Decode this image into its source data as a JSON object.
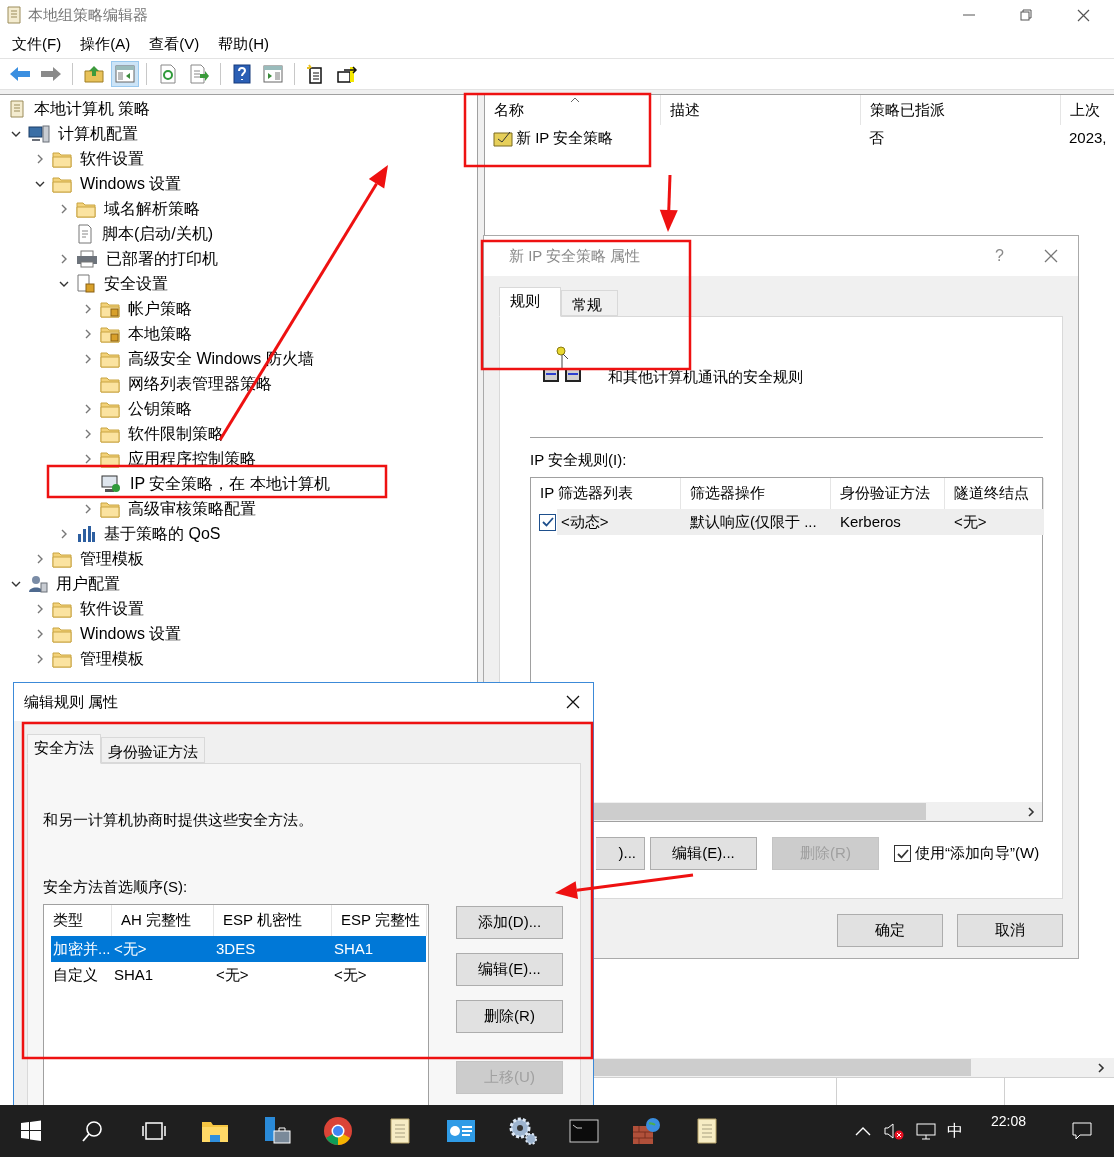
{
  "window": {
    "title": "本地组策略编辑器"
  },
  "menu": [
    "文件(F)",
    "操作(A)",
    "查看(V)",
    "帮助(H)"
  ],
  "toolbar": [
    {
      "kind": "back",
      "pressed": false
    },
    {
      "kind": "forward",
      "pressed": false
    },
    {
      "kind": "separator"
    },
    {
      "kind": "up",
      "pressed": false
    },
    {
      "kind": "tree-pane",
      "pressed": true
    },
    {
      "kind": "separator"
    },
    {
      "kind": "refresh",
      "pressed": false
    },
    {
      "kind": "export",
      "pressed": false
    },
    {
      "kind": "separator"
    },
    {
      "kind": "help",
      "pressed": false
    },
    {
      "kind": "action-pane",
      "pressed": false
    },
    {
      "kind": "separator"
    },
    {
      "kind": "new-doc",
      "pressed": false
    },
    {
      "kind": "move",
      "pressed": false
    }
  ],
  "tree": [
    {
      "label": "本地计算机 策略",
      "kind": "policy",
      "children": [
        {
          "label": "计算机配置",
          "kind": "computer",
          "expanded": true,
          "children": [
            {
              "label": "软件设置",
              "kind": "folder",
              "expanded": false
            },
            {
              "label": "Windows 设置",
              "kind": "folder",
              "expanded": true,
              "children": [
                {
                  "label": "域名解析策略",
                  "kind": "folder",
                  "expanded": false
                },
                {
                  "label": "脚本(启动/关机)",
                  "kind": "script"
                },
                {
                  "label": "已部署的打印机",
                  "kind": "printer",
                  "expanded": false
                },
                {
                  "label": "安全设置",
                  "kind": "security",
                  "expanded": true,
                  "children": [
                    {
                      "label": "帐户策略",
                      "kind": "lock-folder",
                      "expanded": false
                    },
                    {
                      "label": "本地策略",
                      "kind": "lock-folder",
                      "expanded": false
                    },
                    {
                      "label": "高级安全 Windows 防火墙",
                      "kind": "folder",
                      "expanded": false
                    },
                    {
                      "label": "网络列表管理器策略",
                      "kind": "folder"
                    },
                    {
                      "label": "公钥策略",
                      "kind": "folder",
                      "expanded": false
                    },
                    {
                      "label": "软件限制策略",
                      "kind": "folder",
                      "expanded": false
                    },
                    {
                      "label": "应用程序控制策略",
                      "kind": "folder",
                      "expanded": false
                    },
                    {
                      "label": "IP 安全策略，在 本地计算机",
                      "kind": "ipsec"
                    },
                    {
                      "label": "高级审核策略配置",
                      "kind": "folder",
                      "expanded": false
                    }
                  ]
                },
                {
                  "label": "基于策略的 QoS",
                  "kind": "qos",
                  "expanded": false
                }
              ]
            },
            {
              "label": "管理模板",
              "kind": "folder",
              "expanded": false
            }
          ]
        },
        {
          "label": "用户配置",
          "kind": "user",
          "expanded": true,
          "children": [
            {
              "label": "软件设置",
              "kind": "folder",
              "expanded": false
            },
            {
              "label": "Windows 设置",
              "kind": "folder",
              "expanded": false
            },
            {
              "label": "管理模板",
              "kind": "folder",
              "expanded": false
            }
          ]
        }
      ]
    }
  ],
  "list": {
    "columns": [
      "名称",
      "描述",
      "策略已指派",
      "上次"
    ],
    "rows": [
      {
        "cells": [
          "新 IP 安全策略",
          "",
          "否",
          "2023,"
        ]
      }
    ]
  },
  "ip_dialog": {
    "title": "新 IP 安全策略 属性",
    "help": "?",
    "tabs": [
      {
        "label": "规则",
        "selected": true
      },
      {
        "label": "常规",
        "selected": false
      }
    ],
    "description": "和其他计算机通讯的安全规则",
    "rules_label": "IP 安全规则(I):",
    "columns": [
      "IP 筛选器列表",
      "筛选器操作",
      "身份验证方法",
      "隧道终结点"
    ],
    "rows": [
      {
        "checked": true,
        "cells": [
          "<动态>",
          "默认响应(仅限于 ...",
          "Kerberos",
          "<无>"
        ]
      }
    ],
    "buttons": [
      {
        "label": ")...",
        "disabled": false
      },
      {
        "label": "编辑(E)...",
        "disabled": false
      },
      {
        "label": "删除(R)",
        "disabled": true
      }
    ],
    "wizard": {
      "label": "使用“添加向导”(W)",
      "checked": true
    },
    "footer": [
      "确定",
      "取消"
    ]
  },
  "rule_dialog": {
    "title": "编辑规则 属性",
    "tabs": [
      {
        "label": "安全方法",
        "selected": true
      },
      {
        "label": "身份验证方法",
        "selected": false
      }
    ],
    "description": "和另一计算机协商时提供这些安全方法。",
    "order_label": "安全方法首选顺序(S):",
    "columns": [
      "类型",
      "AH 完整性",
      "ESP 机密性",
      "ESP 完整性"
    ],
    "rows": [
      {
        "selected": true,
        "cells": [
          "加密并...",
          "<无>",
          "3DES",
          "SHA1"
        ]
      },
      {
        "selected": false,
        "cells": [
          "自定义",
          "SHA1",
          "<无>",
          "<无>"
        ]
      }
    ],
    "buttons": [
      {
        "label": "添加(D)...",
        "disabled": false
      },
      {
        "label": "编辑(E)...",
        "disabled": false
      },
      {
        "label": "删除(R)",
        "disabled": false
      },
      {
        "label": "上移(U)",
        "disabled": true
      }
    ]
  },
  "taskbar": {
    "ime": "中",
    "clock": "22:08"
  }
}
